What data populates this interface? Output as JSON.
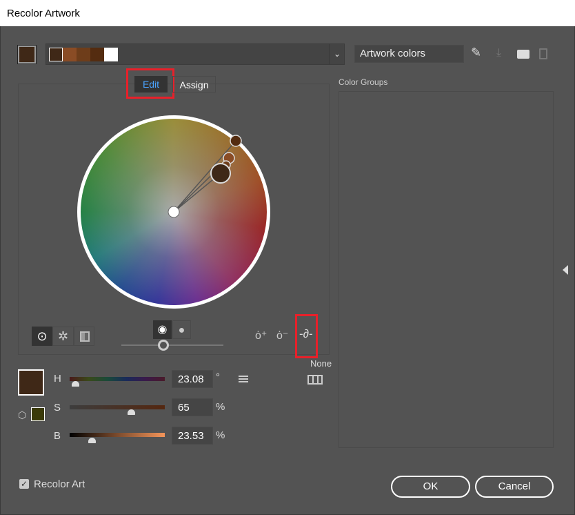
{
  "window": {
    "title": "Recolor Artwork"
  },
  "top": {
    "current_color": "#3f2817",
    "swatches": [
      "#3f2817",
      "#8a4c25",
      "#6e3d1a",
      "#542c10",
      "#ffffff"
    ],
    "group_name": "Artwork colors"
  },
  "tabs": [
    {
      "label": "Edit",
      "active": true
    },
    {
      "label": "Assign",
      "active": false
    }
  ],
  "color_groups": {
    "label": "Color Groups"
  },
  "sliders": {
    "h": {
      "label": "H",
      "value": "23.08",
      "unit": "°",
      "fraction": 0.064
    },
    "s": {
      "label": "S",
      "value": "65",
      "unit": "%",
      "fraction": 0.65
    },
    "b": {
      "label": "B",
      "value": "23.53",
      "unit": "%",
      "fraction": 0.2353
    }
  },
  "harmony": {
    "label": "None"
  },
  "selected_color": "#3f2817",
  "out_of_gamut_color": "#3a3a08",
  "recolor_art": {
    "label": "Recolor Art",
    "checked": true
  },
  "buttons": {
    "ok": "OK",
    "cancel": "Cancel"
  }
}
